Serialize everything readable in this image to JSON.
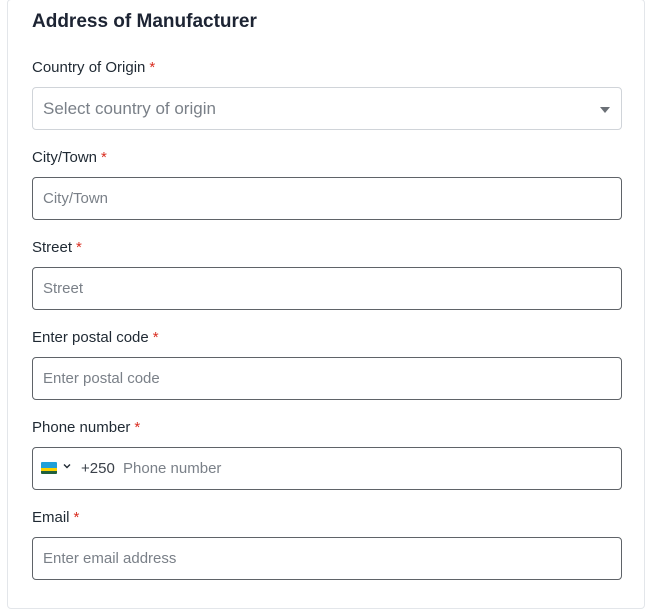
{
  "section": {
    "title": "Address of Manufacturer"
  },
  "fields": {
    "country": {
      "label": "Country of Origin",
      "required_mark": "*",
      "placeholder": "Select country of origin"
    },
    "city": {
      "label": "City/Town",
      "required_mark": "*",
      "placeholder": "City/Town",
      "value": ""
    },
    "street": {
      "label": "Street",
      "required_mark": "*",
      "placeholder": "Street",
      "value": ""
    },
    "postal": {
      "label": "Enter postal code",
      "required_mark": "*",
      "placeholder": "Enter postal code",
      "value": ""
    },
    "phone": {
      "label": "Phone number",
      "required_mark": "*",
      "dial_code": "+250",
      "flag_icon": "rwanda-flag-icon",
      "placeholder": "Phone number",
      "value": ""
    },
    "email": {
      "label": "Email",
      "required_mark": "*",
      "placeholder": "Enter email address",
      "value": ""
    }
  },
  "colors": {
    "required": "#d92d20",
    "border": "#5f6368",
    "placeholder": "#7a8088"
  }
}
